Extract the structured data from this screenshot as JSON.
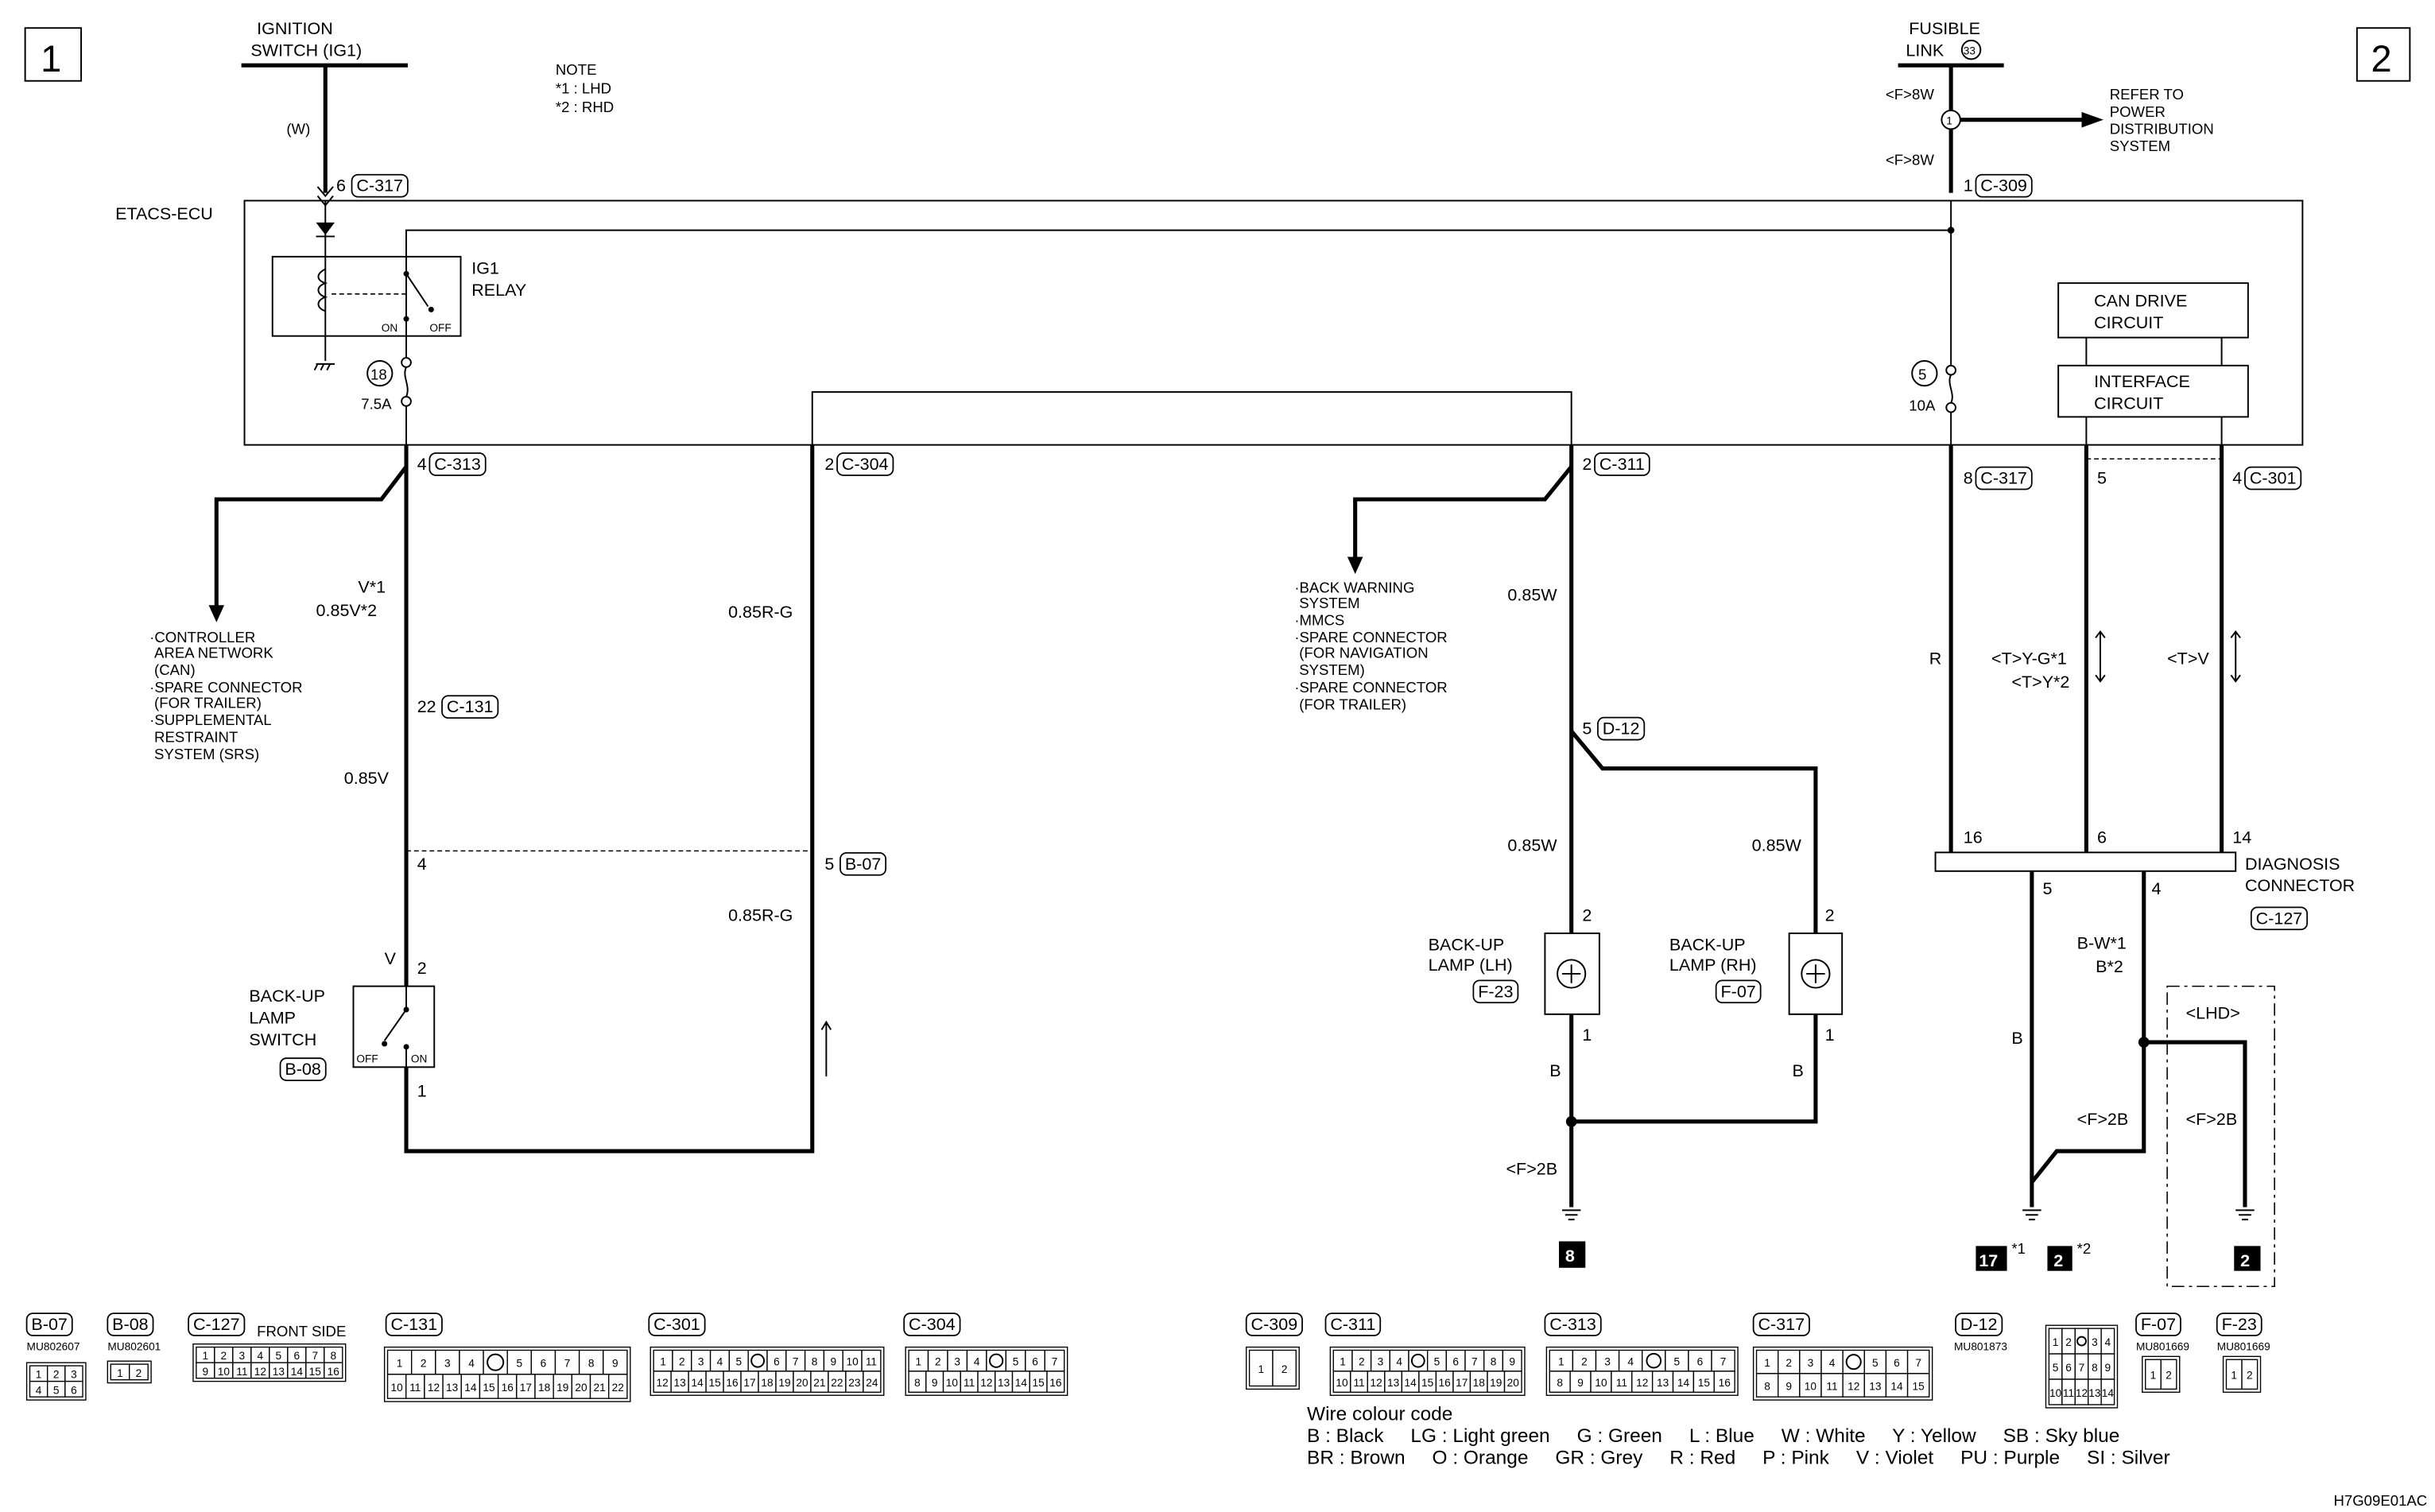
{
  "page_markers": {
    "left": "1",
    "right": "2"
  },
  "note": {
    "title": "NOTE",
    "l1": "*1 : LHD",
    "l2": "*2 : RHD"
  },
  "ignition": {
    "l1": "IGNITION",
    "l2": "SWITCH (IG1)",
    "wire": "(W)",
    "pin": "6",
    "conn": "C-317"
  },
  "fusible": {
    "l1": "FUSIBLE",
    "l2": "LINK",
    "num": "33",
    "wire1": "<F>8W",
    "wire2": "<F>8W",
    "splice": "1",
    "refer": [
      "REFER TO",
      "POWER",
      "DISTRIBUTION",
      "SYSTEM"
    ],
    "pin": "1",
    "conn": "C-309"
  },
  "ecu": {
    "label": "ETACS-ECU",
    "relay_l1": "IG1",
    "relay_l2": "RELAY",
    "on": "ON",
    "off": "OFF",
    "fuse_left_num": "18",
    "fuse_left_rating": "7.5A",
    "fuse_right_num": "5",
    "fuse_right_rating": "10A",
    "can_l1": "CAN DRIVE",
    "can_l2": "CIRCUIT",
    "if_l1": "INTERFACE",
    "if_l2": "CIRCUIT"
  },
  "ecu_pins": [
    {
      "pin": "4",
      "conn": "C-313"
    },
    {
      "pin": "2",
      "conn": "C-304"
    },
    {
      "pin": "2",
      "conn": "C-311"
    },
    {
      "pin": "8",
      "conn": "C-317"
    },
    {
      "pin": "5"
    },
    {
      "pin": "4",
      "conn": "C-301"
    }
  ],
  "left_branch": [
    "·CONTROLLER",
    "AREA NETWORK",
    "(CAN)",
    "·SPARE CONNECTOR",
    "(FOR TRAILER)",
    "·SUPPLEMENTAL",
    "RESTRAINT",
    "SYSTEM (SRS)"
  ],
  "left_circuit": {
    "wire1a": "V*1",
    "wire1b": "0.85V*2",
    "c131_pin": "22",
    "c131": "C-131",
    "wire2": "0.85V",
    "b07_pin_left": "4",
    "wire3": "V",
    "sw_pin2": "2",
    "sw_pin1": "1",
    "switch": [
      "BACK-UP",
      "LAMP",
      "SWITCH"
    ],
    "switch_conn": "B-08",
    "off": "OFF",
    "on": "ON",
    "rg1": "0.85R-G",
    "rg2": "0.85R-G",
    "b07_pin": "5",
    "b07": "B-07"
  },
  "mid_branch": [
    "·BACK WARNING",
    "SYSTEM",
    "·MMCS",
    "·SPARE CONNECTOR",
    "(FOR NAVIGATION",
    "SYSTEM)",
    "·SPARE CONNECTOR",
    "(FOR TRAILER)"
  ],
  "mid_circuit": {
    "wire1": "0.85W",
    "d12_pin": "5",
    "d12": "D-12",
    "wire_lh": "0.85W",
    "wire_rh": "0.85W",
    "lh_pin2": "2",
    "rh_pin2": "2",
    "lh_pin1": "1",
    "rh_pin1": "1",
    "lamp_lh": [
      "BACK-UP",
      "LAMP (LH)"
    ],
    "lamp_lh_conn": "F-23",
    "lamp_rh": [
      "BACK-UP",
      "LAMP (RH)"
    ],
    "lamp_rh_conn": "F-07",
    "b_lh": "B",
    "b_rh": "B",
    "gnd_wire": "<F>2B",
    "ground": "8"
  },
  "right_circuit": {
    "r": "R",
    "yg": "<T>Y-G*1",
    "y": "<T>Y*2",
    "v": "<T>V",
    "p16": "16",
    "p6": "6",
    "p14": "14",
    "diag": [
      "DIAGNOSIS",
      "CONNECTOR"
    ],
    "diag_conn": "C-127",
    "p5": "5",
    "p4": "4",
    "bw": "B-W*1",
    "b2": "B*2",
    "b": "B",
    "f2b1": "<F>2B",
    "f2b2": "<F>2B",
    "lhd": "<LHD>",
    "g17": "17",
    "g17s": "*1",
    "g2": "2",
    "g2s": "*2",
    "g2lhd": "2"
  },
  "connectors": [
    {
      "id": "B-07",
      "part": "MU802607",
      "pins": [
        [
          "1",
          "2",
          "3"
        ],
        [
          "4",
          "5",
          "6"
        ]
      ]
    },
    {
      "id": "B-08",
      "part": "MU802601",
      "pins": [
        [
          "1",
          "2"
        ]
      ]
    },
    {
      "id": "C-127",
      "note": "FRONT SIDE",
      "pins": [
        [
          "1",
          "2",
          "3",
          "4",
          "5",
          "6",
          "7",
          "8"
        ],
        [
          "9",
          "10",
          "11",
          "12",
          "13",
          "14",
          "15",
          "16"
        ]
      ]
    },
    {
      "id": "C-131",
      "pins": [
        [
          "1",
          "2",
          "3",
          "4",
          "",
          "5",
          "6",
          "7",
          "8",
          "9"
        ],
        [
          "10",
          "11",
          "12",
          "13",
          "14",
          "15",
          "16",
          "17",
          "18",
          "19",
          "20",
          "21",
          "22"
        ]
      ]
    },
    {
      "id": "C-301",
      "pins": [
        [
          "1",
          "2",
          "3",
          "4",
          "5",
          "",
          "6",
          "7",
          "8",
          "9",
          "10",
          "11"
        ],
        [
          "12",
          "13",
          "14",
          "15",
          "16",
          "17",
          "18",
          "19",
          "20",
          "21",
          "22",
          "23",
          "24"
        ]
      ]
    },
    {
      "id": "C-304",
      "pins": [
        [
          "1",
          "2",
          "3",
          "4",
          "",
          "5",
          "6",
          "7"
        ],
        [
          "8",
          "9",
          "10",
          "11",
          "12",
          "13",
          "14",
          "15",
          "16"
        ]
      ]
    },
    {
      "id": "C-309",
      "pins": [
        [
          "1",
          "2"
        ]
      ]
    },
    {
      "id": "C-311",
      "pins": [
        [
          "1",
          "2",
          "3",
          "4",
          "",
          "5",
          "6",
          "7",
          "8",
          "9"
        ],
        [
          "10",
          "11",
          "12",
          "13",
          "14",
          "15",
          "16",
          "17",
          "18",
          "19",
          "20"
        ]
      ]
    },
    {
      "id": "C-313",
      "pins": [
        [
          "1",
          "2",
          "3",
          "4",
          "",
          "5",
          "6",
          "7"
        ],
        [
          "8",
          "9",
          "10",
          "11",
          "12",
          "13",
          "14",
          "15",
          "16"
        ]
      ]
    },
    {
      "id": "C-317",
      "pins": [
        [
          "1",
          "2",
          "3",
          "4",
          "",
          "5",
          "6",
          "7"
        ],
        [
          "8",
          "9",
          "10",
          "11",
          "12",
          "13",
          "14",
          "15"
        ]
      ]
    },
    {
      "id": "D-12",
      "part": "MU801873",
      "pins": [
        [
          "1",
          "2",
          "",
          "3",
          "4"
        ],
        [
          "5",
          "6",
          "7",
          "8",
          "9"
        ],
        [
          "10",
          "11",
          "12",
          "13",
          "14"
        ]
      ]
    },
    {
      "id": "F-07",
      "part": "MU801669",
      "pins": [
        [
          "1",
          "2"
        ]
      ]
    },
    {
      "id": "F-23",
      "part": "MU801669",
      "pins": [
        [
          "1",
          "2"
        ]
      ]
    }
  ],
  "wire_colour": {
    "title": "Wire colour code",
    "line1": "B : Black     LG : Light green     G : Green     L : Blue     W : White     Y : Yellow     SB : Sky blue",
    "line2": "BR : Brown     O : Orange     GR : Grey     R : Red     P : Pink     V : Violet     PU : Purple     SI : Silver"
  },
  "drawing_id": "H7G09E01AC"
}
